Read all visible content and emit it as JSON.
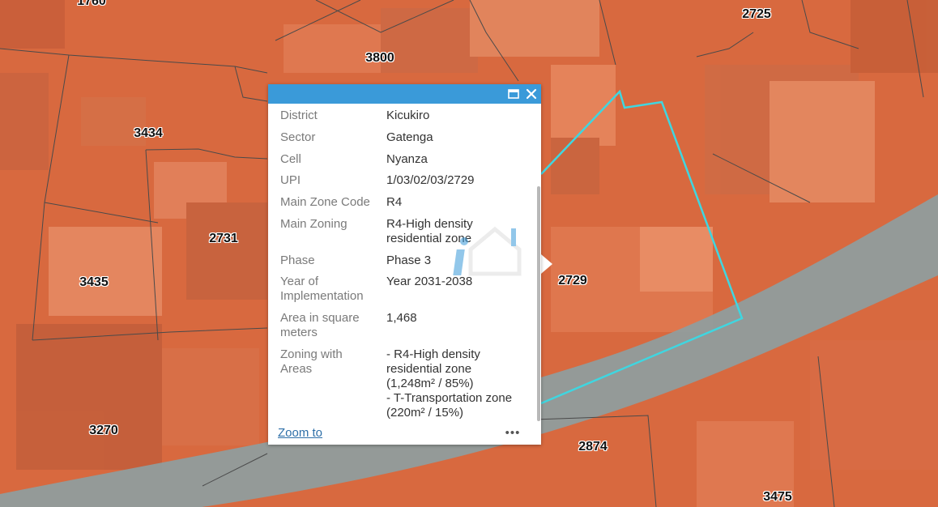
{
  "map": {
    "parcel_labels": [
      {
        "id": "1760",
        "text": "1760"
      },
      {
        "id": "3800",
        "text": "3800"
      },
      {
        "id": "2725",
        "text": "2725"
      },
      {
        "id": "3434",
        "text": "3434"
      },
      {
        "id": "2731",
        "text": "2731"
      },
      {
        "id": "3435",
        "text": "3435"
      },
      {
        "id": "2729",
        "text": "2729"
      },
      {
        "id": "3270",
        "text": "3270"
      },
      {
        "id": "2874",
        "text": "2874"
      },
      {
        "id": "3475",
        "text": "3475"
      }
    ],
    "colors": {
      "zone_fill": "#d96a47",
      "road": "#8e9ea0",
      "selection": "#3fd6e0",
      "parcel_line": "#4a4a4a"
    }
  },
  "popup": {
    "header_color": "#3a9ad9",
    "maximize_icon": "maximize-icon",
    "close_icon": "close-icon",
    "fields": [
      {
        "label": "District",
        "value": "Kicukiro"
      },
      {
        "label": "Sector",
        "value": "Gatenga"
      },
      {
        "label": "Cell",
        "value": "Nyanza"
      },
      {
        "label": "UPI",
        "value": "1/03/02/03/2729"
      },
      {
        "label": "Main Zone Code",
        "value": "R4"
      },
      {
        "label": "Main Zoning",
        "value": "R4-High density\n residential zone"
      },
      {
        "label": "Phase",
        "value": "Phase 3"
      },
      {
        "label": "Year of\nImplementation",
        "value": "Year 2031-2038"
      },
      {
        "label": "Area in square\nmeters",
        "value": "1,468"
      },
      {
        "label": "Zoning with\nAreas",
        "value": "- R4-High density\n residential zone\n(1,248m² / 85%)\n- T-Transportation zone\n(220m² / 15%)"
      }
    ],
    "footer": {
      "zoom_label": "Zoom to",
      "more_label": "•••"
    }
  }
}
